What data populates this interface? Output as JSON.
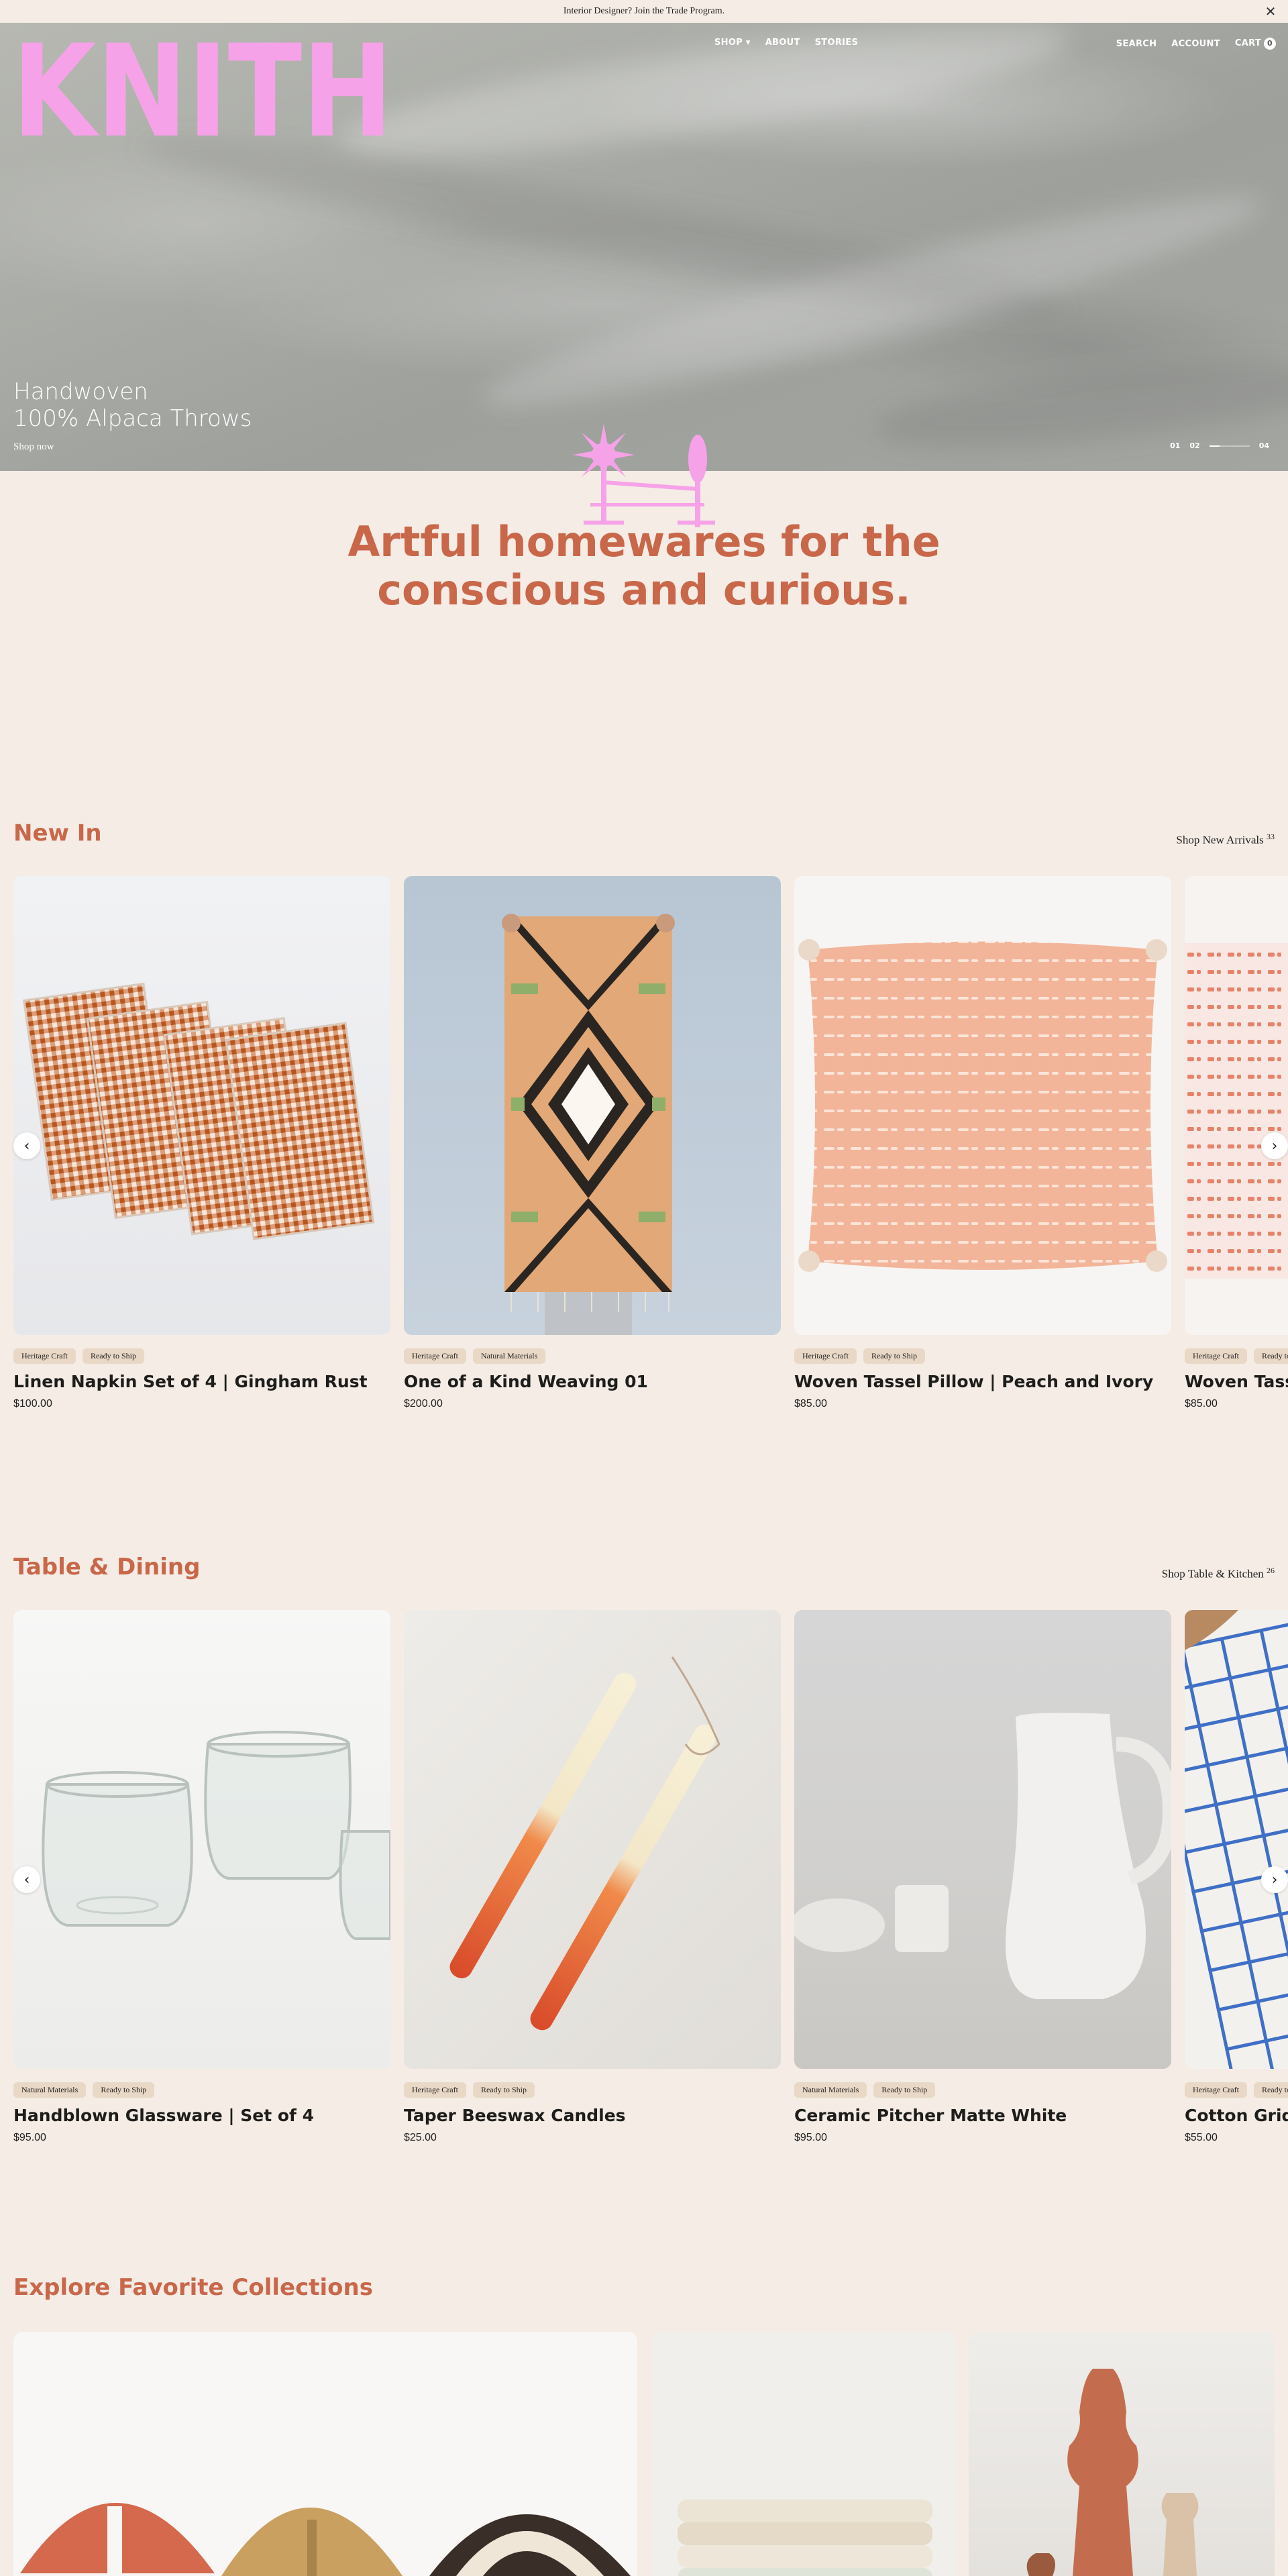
{
  "announcement": {
    "text": "Interior Designer? Join the Trade Program.",
    "close_glyph": "✕"
  },
  "brand": {
    "logo_text": "KNITH",
    "logo_color": "#f6a2e8"
  },
  "nav": {
    "left": [
      "SHOP ▾",
      "ABOUT",
      "STORIES"
    ],
    "search": "SEARCH",
    "account": "ACCOUNT",
    "cart": "CART",
    "cart_count": "0"
  },
  "hero": {
    "title_line1": "Handwoven",
    "title_line2": "100% Alpaca Throws",
    "cta": "Shop now",
    "slide_current": "01",
    "slide_mid": "02",
    "slide_total": "04",
    "progress": 0.25
  },
  "tagline": {
    "line1": "Artful homewares for the",
    "line2": "conscious and curious."
  },
  "colors": {
    "accent": "#c9674a",
    "background": "#f4ece5",
    "tag_bg": "#e9d8c6"
  },
  "new_in": {
    "title": "New In",
    "link": "Shop New Arrivals",
    "count": "33",
    "products": [
      {
        "tags": [
          "Heritage Craft",
          "Ready to Ship"
        ],
        "name": "Linen Napkin Set of 4 | Gingham Rust",
        "price": "$100.00"
      },
      {
        "tags": [
          "Heritage Craft",
          "Natural Materials"
        ],
        "name": "One of a Kind Weaving 01",
        "price": "$200.00"
      },
      {
        "tags": [
          "Heritage Craft",
          "Ready to Ship"
        ],
        "name": "Woven Tassel Pillow | Peach and Ivory",
        "price": "$85.00"
      },
      {
        "tags": [
          "Heritage Craft",
          "Ready to Ship"
        ],
        "name": "Woven Tassel Pillow",
        "price": "$85.00"
      }
    ]
  },
  "table_dining": {
    "title": "Table & Dining",
    "link": "Shop Table & Kitchen",
    "count": "26",
    "products": [
      {
        "tags": [
          "Natural Materials",
          "Ready to Ship"
        ],
        "name": "Handblown Glassware | Set of 4",
        "price": "$95.00"
      },
      {
        "tags": [
          "Heritage Craft",
          "Ready to Ship"
        ],
        "name": "Taper Beeswax Candles",
        "price": "$25.00"
      },
      {
        "tags": [
          "Natural Materials",
          "Ready to Ship"
        ],
        "name": "Ceramic Pitcher Matte White",
        "price": "$95.00"
      },
      {
        "tags": [
          "Heritage Craft",
          "Ready to Ship"
        ],
        "name": "Cotton Grid Napkins",
        "price": "$55.00"
      }
    ]
  },
  "collections": {
    "title": "Explore Favorite Collections"
  }
}
